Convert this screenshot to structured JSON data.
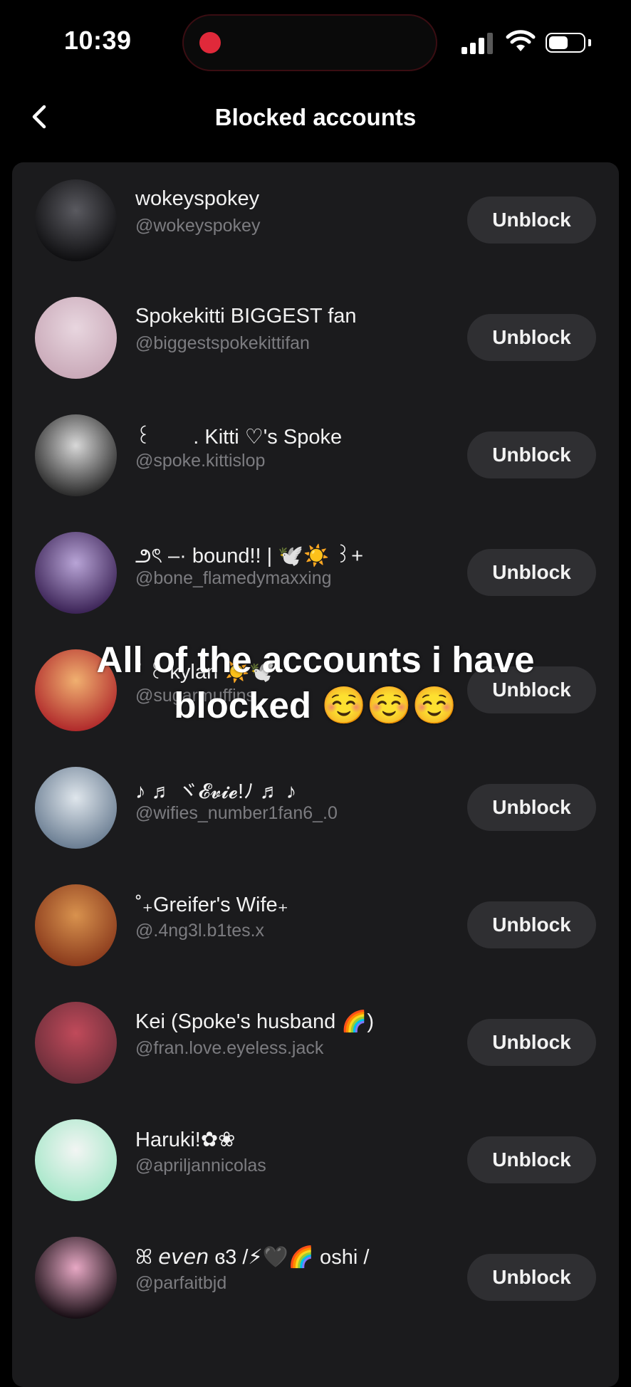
{
  "status_bar": {
    "time": "10:39"
  },
  "header": {
    "title": "Blocked accounts"
  },
  "accounts": [
    {
      "name": "wokeyspokey",
      "handle": "@wokeyspokey",
      "button": "Unblock",
      "avatar_colors": [
        "#0e0e10",
        "#5a5a60"
      ]
    },
    {
      "name": "Spokekitti BIGGEST fan",
      "handle": "@biggestspokekittifan",
      "button": "Unblock",
      "avatar_colors": [
        "#c9a9b8",
        "#e8d6df"
      ]
    },
    {
      "name": "꒰ ⠀⠀ . Kitti ♡'s Spoke",
      "handle": "@spoke.kittislop",
      "button": "Unblock",
      "avatar_colors": [
        "#2a2a2a",
        "#d8d8d8"
      ]
    },
    {
      "name": "౨ৎ –· bound!! | 🕊️☀️ ꒱+",
      "handle": "@bone_flamedymaxxing",
      "button": "Unblock",
      "avatar_colors": [
        "#3b2356",
        "#b8a4d6"
      ]
    },
    {
      "name": "˚ ꒰ kylan ☀️🕊️",
      "handle": "@sugarmuffins",
      "button": "Unblock",
      "avatar_colors": [
        "#b0292b",
        "#f0b070"
      ]
    },
    {
      "name": "♪ ♬ ヾ𝓔𝓿𝓲𝓮!ﾉ ♬ ♪",
      "handle": "@wifies_number1fan6_.0",
      "button": "Unblock",
      "avatar_colors": [
        "#6a7d92",
        "#dfe6ec"
      ]
    },
    {
      "name": "˚₊Greifer's Wife₊",
      "handle": "@.4ng3l.b1tes.x",
      "button": "Unblock",
      "avatar_colors": [
        "#8a3a1c",
        "#d8924e"
      ]
    },
    {
      "name": "Kei (Spoke's husband 🌈)",
      "handle": "@fran.love.eyeless.jack",
      "button": "Unblock",
      "avatar_colors": [
        "#6b2e3a",
        "#c04a5a"
      ]
    },
    {
      "name": "Haruki!✿❀",
      "handle": "@apriljannicolas",
      "button": "Unblock",
      "avatar_colors": [
        "#a6e7c9",
        "#f2f5f3"
      ]
    },
    {
      "name": "ꕤ 𝘦𝘷𝘦𝘯 ɞ3 /⚡🖤🌈 oshi /",
      "handle": "@parfaitbjd",
      "button": "Unblock",
      "avatar_colors": [
        "#150c12",
        "#e7a8c4"
      ]
    }
  ],
  "caption": "All of the accounts i have blocked ☺️☺️☺️"
}
